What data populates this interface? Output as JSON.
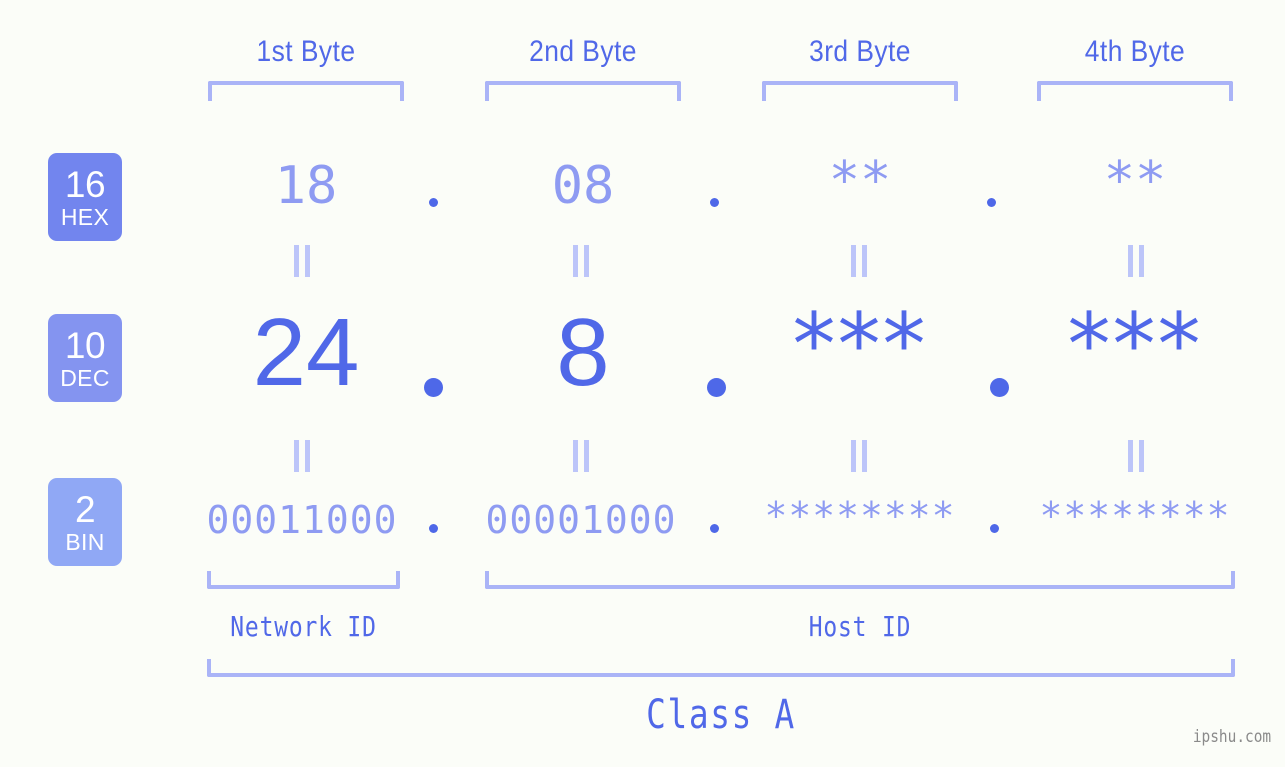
{
  "meta": {
    "watermark": "ipshu.com",
    "accent": "#5068e8",
    "accent_light": "#8e9bf2",
    "bracket_color": "#aab4f7",
    "background": "#fbfdf8"
  },
  "byte_headers": [
    {
      "label": "1st Byte"
    },
    {
      "label": "2nd Byte"
    },
    {
      "label": "3rd Byte"
    },
    {
      "label": "4th Byte"
    }
  ],
  "bases": [
    {
      "number": "16",
      "name": "HEX",
      "color": "#7285ee"
    },
    {
      "number": "10",
      "name": "DEC",
      "color": "#8494f0"
    },
    {
      "number": "2",
      "name": "BIN",
      "color": "#90a8f5"
    }
  ],
  "rows": {
    "hex": {
      "base_label": "16",
      "base_name": "HEX",
      "values": [
        "18",
        "08",
        "**",
        "**"
      ],
      "separator": "."
    },
    "dec": {
      "base_label": "10",
      "base_name": "DEC",
      "values": [
        "24",
        "8",
        "***",
        "***"
      ],
      "separator": "."
    },
    "bin": {
      "base_label": "2",
      "base_name": "BIN",
      "values": [
        "00011000",
        "00001000",
        "********",
        "********"
      ],
      "separator": "."
    }
  },
  "equality_mark": "=",
  "sections": [
    {
      "label": "Network ID"
    },
    {
      "label": "Host ID"
    }
  ],
  "class": {
    "label": "Class A"
  }
}
